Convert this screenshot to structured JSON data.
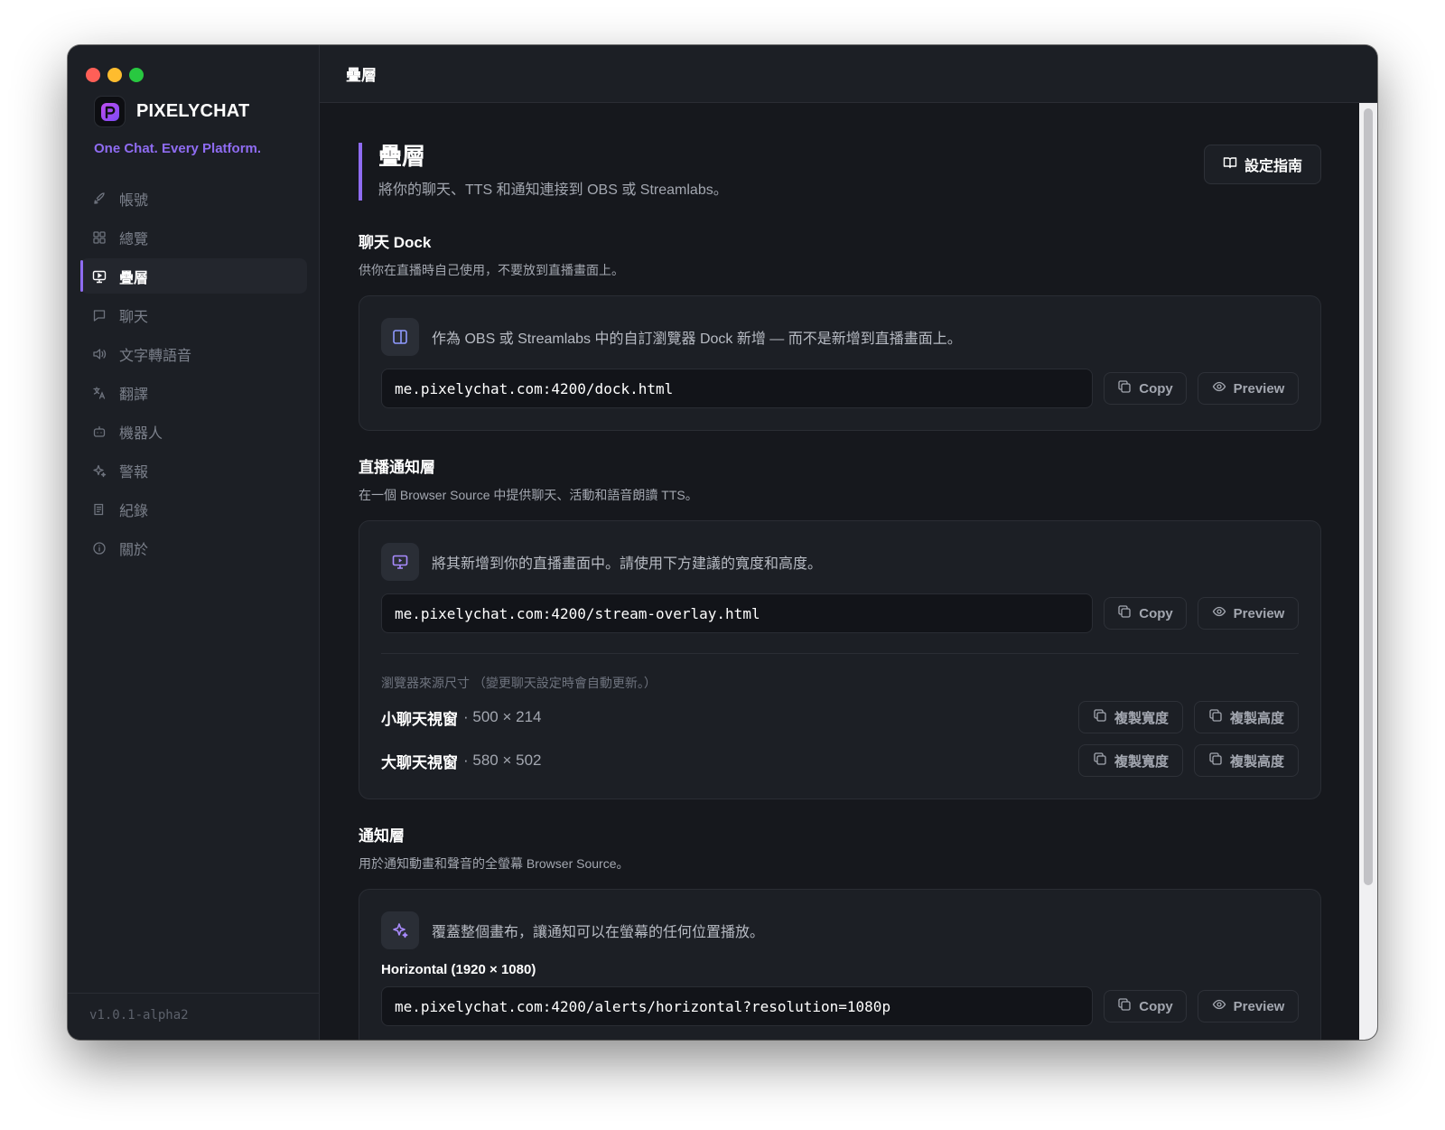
{
  "app": {
    "name": "PIXELYCHAT",
    "tagline": "One Chat. Every Platform.",
    "version": "v1.0.1-alpha2"
  },
  "sidebar": {
    "items": [
      {
        "label": "帳號",
        "icon": "rocket-icon"
      },
      {
        "label": "總覽",
        "icon": "grid-icon"
      },
      {
        "label": "疊層",
        "icon": "monitor-play-icon",
        "active": true
      },
      {
        "label": "聊天",
        "icon": "chat-bubble-icon"
      },
      {
        "label": "文字轉語音",
        "icon": "speaker-icon"
      },
      {
        "label": "翻譯",
        "icon": "translate-icon"
      },
      {
        "label": "機器人",
        "icon": "bot-icon"
      },
      {
        "label": "警報",
        "icon": "sparkle-icon"
      },
      {
        "label": "紀錄",
        "icon": "log-icon"
      },
      {
        "label": "關於",
        "icon": "info-icon"
      }
    ]
  },
  "topbar": {
    "title": "疊層"
  },
  "page": {
    "title": "疊層",
    "subtitle": "將你的聊天、TTS 和通知連接到 OBS 或 Streamlabs。",
    "guide_button": "設定指南"
  },
  "buttons": {
    "copy": "Copy",
    "preview": "Preview",
    "copy_width": "複製寬度",
    "copy_height": "複製高度"
  },
  "dock": {
    "title": "聊天 Dock",
    "subtitle": "供你在直播時自己使用，不要放到直播畫面上。",
    "description": "作為 OBS 或 Streamlabs 中的自訂瀏覽器 Dock 新增 — 而不是新增到直播畫面上。",
    "url": "me.pixelychat.com:4200/dock.html"
  },
  "stream_overlay": {
    "title": "直播通知層",
    "subtitle": "在一個 Browser Source 中提供聊天、活動和語音朗讀 TTS。",
    "description": "將其新增到你的直播畫面中。請使用下方建議的寬度和高度。",
    "url": "me.pixelychat.com:4200/stream-overlay.html",
    "sizes_caption": "瀏覽器來源尺寸 （變更聊天設定時會自動更新。）",
    "sizes": [
      {
        "name": "小聊天視窗",
        "dim": "· 500 × 214"
      },
      {
        "name": "大聊天視窗",
        "dim": "· 580 × 502"
      }
    ]
  },
  "alerts": {
    "title": "通知層",
    "subtitle": "用於通知動畫和聲音的全螢幕 Browser Source。",
    "description": "覆蓋整個畫布，讓通知可以在螢幕的任何位置播放。",
    "horizontal_label": "Horizontal (1920 × 1080)",
    "url": "me.pixelychat.com:4200/alerts/horizontal?resolution=1080p"
  },
  "colors": {
    "accent": "#8f6cf2",
    "background": "#16181d",
    "panel": "#1c1f25"
  }
}
